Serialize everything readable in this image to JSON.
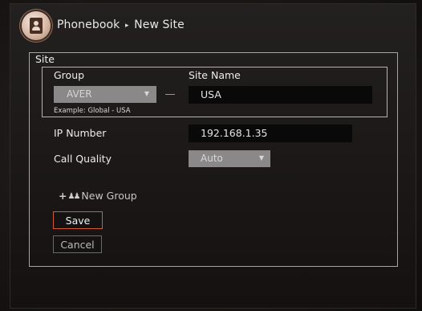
{
  "header": {
    "title_part1": "Phonebook",
    "arrow": "▸",
    "title_part2": "New Site",
    "icon": "phonebook-contact-icon"
  },
  "form": {
    "legend": "Site",
    "group": {
      "label": "Group",
      "selected": "AVER",
      "hint": "Example: Global - USA"
    },
    "site_name": {
      "label": "Site Name",
      "value": "USA"
    },
    "ip_number": {
      "label": "IP Number",
      "value": "192.168.1.35"
    },
    "call_quality": {
      "label": "Call Quality",
      "selected": "Auto"
    },
    "new_group": {
      "label": "New Group",
      "icon": "add-group-icon"
    },
    "save_label": "Save",
    "cancel_label": "Cancel"
  },
  "colors": {
    "background": "#1b1716",
    "focus_border": "#d05a3a",
    "select_bg": "#8a8888",
    "input_bg": "#0a0909"
  }
}
